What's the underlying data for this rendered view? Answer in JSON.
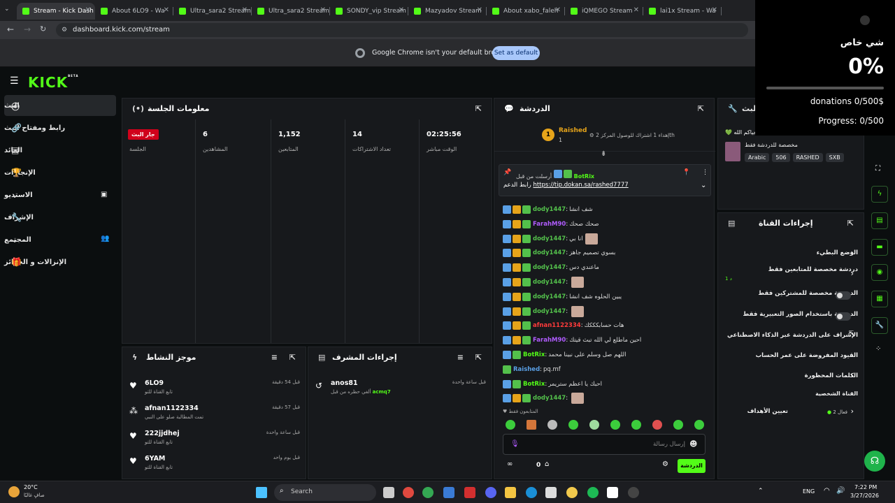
{
  "browser": {
    "tabs": [
      {
        "label": "Stream - Kick Dash"
      },
      {
        "label": "About 6LO9 - Wa"
      },
      {
        "label": "Ultra_sara2 Stream"
      },
      {
        "label": "Ultra_sara2 Stream"
      },
      {
        "label": "SONDY_vip Stream"
      },
      {
        "label": "Mazyadov Stream"
      },
      {
        "label": "About xabo_faleh"
      },
      {
        "label": "iQMEGO Stream"
      },
      {
        "label": "lai1x Stream - Wa"
      }
    ],
    "url": "dashboard.kick.com/stream",
    "infobar_message": "Google Chrome isn't your default browser",
    "infobar_button": "Set as default"
  },
  "header": {
    "logo": "KICK",
    "beta": "BETA"
  },
  "sidebar": {
    "items": [
      {
        "label": "البث",
        "icon": "signal-icon"
      },
      {
        "label": "رابط ومفتاح البث",
        "icon": "link-icon"
      },
      {
        "label": "العائد",
        "icon": "chart-icon"
      },
      {
        "label": "الإنجازات",
        "icon": "trophy-icon"
      },
      {
        "label": "الاستديو",
        "icon": "studio-icon"
      },
      {
        "label": "الإشراف",
        "icon": "wrench-icon"
      },
      {
        "label": "المجتمع",
        "icon": "community-icon"
      },
      {
        "label": "الإنزالات و الجوائز",
        "icon": "gift-icon"
      }
    ]
  },
  "session": {
    "title": "معلومات الجلسة",
    "live_badge": "جار البث",
    "stats": [
      {
        "value": "",
        "label": "الجلسة"
      },
      {
        "value": "6",
        "label": "المشاهدين"
      },
      {
        "value": "1,152",
        "label": "المتابعين"
      },
      {
        "value": "14",
        "label": "تعداد الاشتراكات"
      },
      {
        "value": "02:25:56",
        "label": "الوقت مباشر"
      }
    ]
  },
  "activity": {
    "title": "موجز النشاط",
    "items": [
      {
        "name": "6LO9",
        "sub": "تابع القناة للتو",
        "time": "قبل 54 دقيقة"
      },
      {
        "name": "afnan1122334",
        "sub": "تمت المطالبة صلو على النبي",
        "time": "قبل 57 دقيقة"
      },
      {
        "name": "222jjdhej",
        "sub": "تابع القناة للتو",
        "time": "قبل ساعة واحدة"
      },
      {
        "name": "6YAM",
        "sub": "تابع القناة للتو",
        "time": "قبل يوم واحد"
      }
    ]
  },
  "modactions": {
    "title": "إجراءات المشرف",
    "items": [
      {
        "name": "anos81",
        "sub": "ألغي حظره من قبل",
        "by": "acmq7",
        "time": "قبل ساعة واحدة"
      }
    ]
  },
  "chat": {
    "title": "الدردشة",
    "goal_user": "Raished",
    "goal_count": "1",
    "goal_text": "إهداء 1 اشتراك للوصول المركز 2",
    "goal_suffix": "th",
    "pinned_by": "BotRix",
    "pinned_prefix": "أرسلت من قبل",
    "pinned_link": "https://tip.dokan.sa/rashed7777",
    "pinned_label": "رابط الدعم",
    "messages": [
      {
        "user": "dody1447",
        "color": "#53c04b",
        "text": "شف انشا"
      },
      {
        "user": "FarahM90",
        "color": "#b05cff",
        "text": "صحك صحك"
      },
      {
        "user": "dody1447",
        "color": "#53c04b",
        "text": "انا بي"
      },
      {
        "user": "dody1447",
        "color": "#53c04b",
        "text": "بسوي تصميم جاهز"
      },
      {
        "user": "dody1447",
        "color": "#53c04b",
        "text": "ماعندي دس"
      },
      {
        "user": "dody1447",
        "color": "#53c04b",
        "text": ""
      },
      {
        "user": "dody1447",
        "color": "#53c04b",
        "text": "يبين الحلوه شف انشا"
      },
      {
        "user": "dody1447",
        "color": "#53c04b",
        "text": ""
      },
      {
        "user": "afnan1122334",
        "color": "#ff3b3b",
        "text": "هات حسابكككك"
      },
      {
        "user": "FarahM90",
        "color": "#b05cff",
        "text": "احين ماطلع لي الله تبث قيتك"
      },
      {
        "user": "BotRix",
        "color": "#53fc18",
        "text": "اللهم صل وسلم على نبينا محمد"
      },
      {
        "user": "Raished",
        "color": "#5aa0e6",
        "text": "pq.mf"
      },
      {
        "user": "BotRix",
        "color": "#53fc18",
        "text": "احبك يا اعظم ستريمر"
      },
      {
        "user": "dody1447",
        "color": "#53c04b",
        "text": ""
      }
    ],
    "followers_only": "المتابعون فقط",
    "input_placeholder": "إرسال رسالة",
    "send_button": "الدردشة",
    "viewers_count": "0"
  },
  "channel": {
    "title": "إجراءات القناة",
    "stream_title_label": "البث",
    "stream_user": "حياكم الله",
    "stream_sub": "مخصصة للدردشة فقط",
    "tags": [
      "Arabic",
      "506",
      "RASHED",
      "SXB"
    ],
    "rows": [
      {
        "label": "الوضع البطيء",
        "type": "chev"
      },
      {
        "label": "دردشة مخصصة للمتابعين فقط",
        "sub": "1 د",
        "type": "chev"
      },
      {
        "label": "الدردشة مخصصة للمشتركين فقط",
        "type": "toggle"
      },
      {
        "label": "الدردشة باستخدام الصور التعبيرية فقط",
        "type": "toggle"
      },
      {
        "label": "الإشراف على الدردشة عبر الذكاء الاصطناعي",
        "type": "ext"
      },
      {
        "label": "القيود المفروضة على عمر الحساب",
        "type": "chev"
      },
      {
        "label": "الكلمات المحظورة",
        "type": "chev"
      }
    ],
    "section": "القناة الشخصية",
    "goal_label": "تعيين الأهداف",
    "goal_status": "فعال 2"
  },
  "overlay": {
    "title": "شي خاص",
    "percent": "0%",
    "donations": "donations 0/500$",
    "progress_text": "Progress: 0/500",
    "progress": 0
  },
  "taskbar": {
    "weather_temp": "20°C",
    "weather_desc": "صافٍ غالبًا",
    "search": "Search",
    "lang": "ENG",
    "time": "7:22 PM",
    "date": "3/27/2026"
  }
}
